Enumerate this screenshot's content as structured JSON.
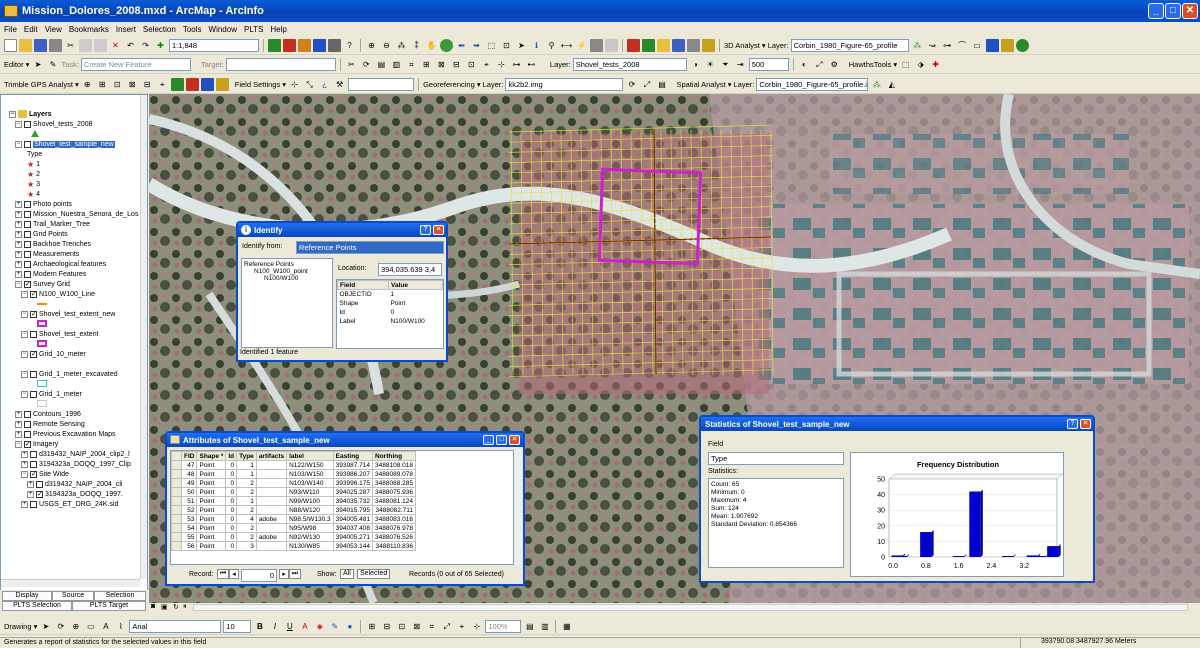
{
  "title": "Mission_Dolores_2008.mxd - ArcMap - ArcInfo",
  "menu": [
    "File",
    "Edit",
    "View",
    "Bookmarks",
    "Insert",
    "Selection",
    "Tools",
    "Window",
    "PLTS",
    "Help"
  ],
  "toolbar1": {
    "scale": "1:1,848",
    "analyst": "3D Analyst ▾",
    "layer_label": "Layer:",
    "layer_value": "Corbin_1980_Figure-65_profile"
  },
  "toolbar2": {
    "editor": "Editor ▾",
    "task_label": "Task:",
    "task_value": "Create New Feature",
    "target_label": "Target:",
    "layer_label": "Layer:",
    "layer_value": "Shovel_tests_2008",
    "zoom": "500",
    "hawths": "HawthsTools ▾"
  },
  "toolbar3": {
    "trimble": "Trimble GPS Analyst ▾",
    "field_settings": "Field Settings ▾",
    "georef": "Georeferencing ▾",
    "layer_label": "Layer:",
    "layer_value": "kk2b2.img",
    "spatial": "Spatial Analyst ▾",
    "layer2_label": "Layer:",
    "layer2_value": "Corbin_1980_Figure-65_profile.in"
  },
  "toc": {
    "root": "Layers",
    "items": [
      {
        "t": "Shovel_tests_2008",
        "l": 1,
        "cb": "☐",
        "pm": "⊟"
      },
      {
        "t": "Shovel_test_sample_new",
        "l": 1,
        "cb": "☐",
        "pm": "⊟",
        "hl": true
      },
      {
        "t": "Type",
        "l": 3
      },
      {
        "t": "1",
        "l": 3,
        "star": true
      },
      {
        "t": "2",
        "l": 3,
        "star": true
      },
      {
        "t": "3",
        "l": 3,
        "star": true
      },
      {
        "t": "4",
        "l": 3,
        "star": true
      },
      {
        "t": "Photo points",
        "l": 1,
        "cb": "☐",
        "pm": "⊞"
      },
      {
        "t": "Mission_Nuestra_Senora_de_Los",
        "l": 1,
        "cb": "☐",
        "pm": "⊞"
      },
      {
        "t": "Trail_Marker_Tree",
        "l": 1,
        "cb": "☐",
        "pm": "⊞"
      },
      {
        "t": "Grid Points",
        "l": 1,
        "cb": "☐",
        "pm": "⊞"
      },
      {
        "t": "Backhoe Trenches",
        "l": 1,
        "cb": "☐",
        "pm": "⊞"
      },
      {
        "t": "Measurements",
        "l": 1,
        "cb": "☐",
        "pm": "⊞"
      },
      {
        "t": "Archaeological features",
        "l": 1,
        "cb": "☐",
        "pm": "⊞"
      },
      {
        "t": "Modern Features",
        "l": 1,
        "cb": "☐",
        "pm": "⊞"
      },
      {
        "t": "Survey Grid",
        "l": 1,
        "cb": "☑",
        "pm": "⊟"
      },
      {
        "t": "N100_W100_Line",
        "l": 2,
        "cb": "☑",
        "pm": "⊟"
      },
      {
        "t": "Shovel_test_extent_new",
        "l": 2,
        "cb": "☑",
        "pm": "⊟"
      },
      {
        "t": "Shovel_test_extent",
        "l": 2,
        "cb": "☐",
        "pm": "⊟"
      },
      {
        "t": "Grid_10_meter",
        "l": 2,
        "cb": "☑",
        "pm": "⊟"
      },
      {
        "t": "Grid_1_meter_excavated",
        "l": 2,
        "cb": "☐",
        "pm": "⊟"
      },
      {
        "t": "Grid_1_meter",
        "l": 2,
        "cb": "☐",
        "pm": "⊟"
      },
      {
        "t": "Contours_1996",
        "l": 1,
        "cb": "☐",
        "pm": "⊞"
      },
      {
        "t": "Remote Sensing",
        "l": 1,
        "cb": "☐",
        "pm": "⊞"
      },
      {
        "t": "Previous Excavation Maps",
        "l": 1,
        "cb": "☐",
        "pm": "⊞"
      },
      {
        "t": "Imagery",
        "l": 1,
        "cb": "☑",
        "pm": "⊟"
      },
      {
        "t": "d319432_NAIP_2004_clip2_l",
        "l": 2,
        "cb": "☐",
        "pm": "⊞"
      },
      {
        "t": "3194323a_DOQQ_1997_Clip",
        "l": 2,
        "cb": "☐",
        "pm": "⊞"
      },
      {
        "t": "Site Wide",
        "l": 2,
        "cb": "☑",
        "pm": "⊟"
      },
      {
        "t": "d319432_NAIP_2004_cli",
        "l": 3,
        "cb": "☐",
        "pm": "⊞"
      },
      {
        "t": "3194323a_DOQQ_1997.",
        "l": 3,
        "cb": "☑",
        "pm": "⊞"
      },
      {
        "t": "USGS_ET_DRG_24K.sid",
        "l": 2,
        "cb": "☐",
        "pm": "⊞"
      }
    ],
    "tabs": [
      "Display",
      "Source",
      "Selection",
      "PLTS Selection",
      "PLTS Target"
    ]
  },
  "identify": {
    "title": "Identify",
    "from_label": "Identify from:",
    "from_value": "Reference Points",
    "tree": [
      "Reference Points",
      "N100_W100_point",
      "N100/W100"
    ],
    "location_label": "Location:",
    "location_value": "394,035.639 3,4",
    "col_field": "Field",
    "col_value": "Value",
    "rows": [
      [
        "OBJECTID",
        "1"
      ],
      [
        "Shape",
        "Point"
      ],
      [
        "Id",
        "0"
      ],
      [
        "Label",
        "N100/W100"
      ]
    ],
    "status": "Identified 1 feature"
  },
  "attributes": {
    "title": "Attributes of Shovel_test_sample_new",
    "columns": [
      "FID",
      "Shape *",
      "Id",
      "Type",
      "artifacts",
      "label",
      "Easting",
      "Northing"
    ],
    "rows": [
      [
        "47",
        "Point",
        "0",
        "1",
        "",
        "N122/W150",
        "393987.714",
        "3488108.018"
      ],
      [
        "48",
        "Point",
        "0",
        "1",
        "",
        "N103/W150",
        "393986.207",
        "3488089.078"
      ],
      [
        "49",
        "Point",
        "0",
        "2",
        "",
        "N103/W140",
        "393996.175",
        "3488088.285"
      ],
      [
        "50",
        "Point",
        "0",
        "2",
        "",
        "N93/W110",
        "394025.287",
        "3488075.936"
      ],
      [
        "51",
        "Point",
        "0",
        "1",
        "",
        "N99/W100",
        "394035.732",
        "3488081.124"
      ],
      [
        "52",
        "Point",
        "0",
        "2",
        "",
        "N88/W120",
        "394015.795",
        "3488082.711"
      ],
      [
        "53",
        "Point",
        "0",
        "4",
        "adobe",
        "N98.5/W130.3",
        "394005.481",
        "3488083.016"
      ],
      [
        "54",
        "Point",
        "0",
        "2",
        "",
        "N95/W98",
        "394037.408",
        "3488076.978"
      ],
      [
        "55",
        "Point",
        "0",
        "2",
        "adobe",
        "N92/W130",
        "394005.271",
        "3488076.526"
      ],
      [
        "56",
        "Point",
        "0",
        "3",
        "",
        "N130/W85",
        "394053.144",
        "3488110.836"
      ]
    ],
    "record_label": "Record:",
    "record_value": "0",
    "show_label": "Show:",
    "show_all": "All",
    "show_selected": "Selected",
    "records_text": "Records (0 out of 65 Selected)"
  },
  "statistics": {
    "title": "Statistics of Shovel_test_sample_new",
    "field_label": "Field",
    "field_value": "Type",
    "stats_label": "Statistics:",
    "stats": [
      "Count:   65",
      "Minimum: 0",
      "Maximum: 4",
      "Sum:     124",
      "Mean:    1.907692",
      "Standard Deviation: 0.854366"
    ]
  },
  "chart_data": {
    "type": "bar",
    "title": "Frequency Distribution",
    "x": [
      0.1,
      0.2,
      0.8,
      1.6,
      2.0,
      2.8,
      3.4,
      3.6,
      3.9
    ],
    "values": [
      1,
      0,
      16,
      0,
      42,
      0,
      1,
      0,
      7
    ],
    "y_ticks": [
      0,
      10,
      20,
      30,
      40,
      50
    ],
    "x_ticks": [
      "0.0",
      "0.8",
      "1.6",
      "2.4",
      "3.2"
    ],
    "ylim": [
      0,
      50
    ],
    "xlim": [
      -0.1,
      4.0
    ],
    "color": "#0000cc"
  },
  "drawing": {
    "label": "Drawing ▾",
    "font": "Arial",
    "size": "10",
    "zoom": "100%"
  },
  "status": {
    "text": "Generates a report of statistics for the selected values in this field",
    "coords": "393790.08  3487927.96 Meters"
  }
}
